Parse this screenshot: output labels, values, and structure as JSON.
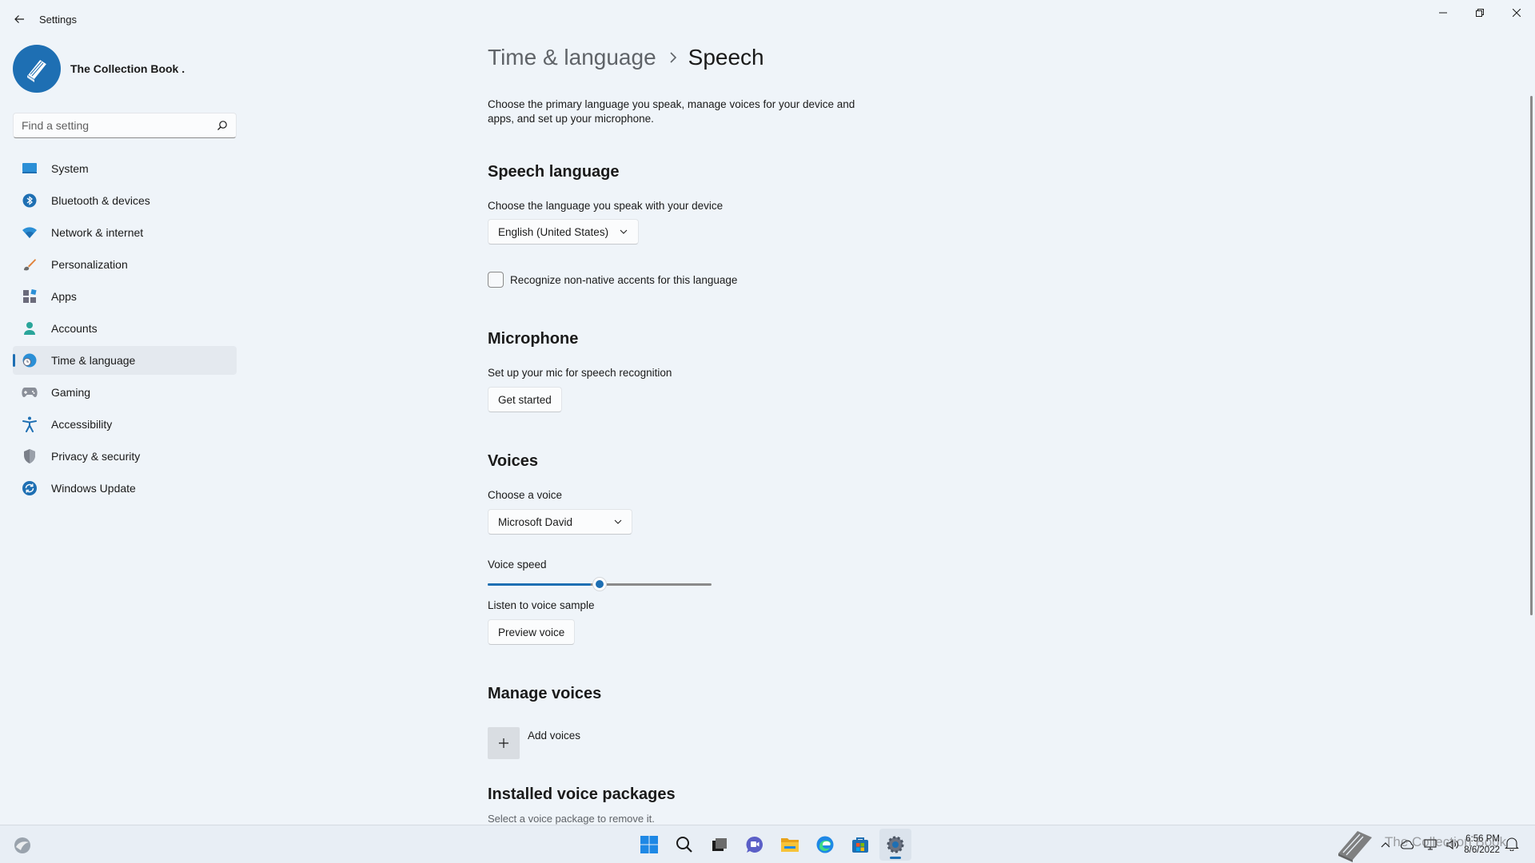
{
  "window": {
    "title": "Settings"
  },
  "profile": {
    "name": "The Collection Book ."
  },
  "search": {
    "placeholder": "Find a setting",
    "value": ""
  },
  "sidebar": {
    "items": [
      {
        "label": "System",
        "icon": "monitor-icon"
      },
      {
        "label": "Bluetooth & devices",
        "icon": "bluetooth-icon"
      },
      {
        "label": "Network & internet",
        "icon": "wifi-icon"
      },
      {
        "label": "Personalization",
        "icon": "brush-icon"
      },
      {
        "label": "Apps",
        "icon": "apps-icon"
      },
      {
        "label": "Accounts",
        "icon": "person-icon"
      },
      {
        "label": "Time & language",
        "icon": "globe-clock-icon",
        "active": true
      },
      {
        "label": "Gaming",
        "icon": "gamepad-icon"
      },
      {
        "label": "Accessibility",
        "icon": "accessibility-icon"
      },
      {
        "label": "Privacy & security",
        "icon": "shield-icon"
      },
      {
        "label": "Windows Update",
        "icon": "update-icon"
      }
    ]
  },
  "breadcrumb": {
    "parent": "Time & language",
    "current": "Speech"
  },
  "description": "Choose the primary language you speak, manage voices for your device and apps, and set up your microphone.",
  "speech_language": {
    "title": "Speech language",
    "label": "Choose the language you speak with your device",
    "selected": "English (United States)",
    "checkbox_label": "Recognize non-native accents for this language",
    "checkbox_checked": false
  },
  "microphone": {
    "title": "Microphone",
    "label": "Set up your mic for speech recognition",
    "button": "Get started"
  },
  "voices": {
    "title": "Voices",
    "choose_label": "Choose a voice",
    "selected_voice": "Microsoft David",
    "speed_label": "Voice speed",
    "speed_value": 0.5,
    "sample_label": "Listen to voice sample",
    "preview_button": "Preview voice"
  },
  "manage_voices": {
    "title": "Manage voices",
    "add_label": "Add voices"
  },
  "installed": {
    "title": "Installed voice packages",
    "subtitle": "Select a voice package to remove it."
  },
  "taskbar": {
    "apps": [
      "start-icon",
      "search-icon",
      "task-view-icon",
      "chat-icon",
      "file-explorer-icon",
      "edge-icon",
      "store-icon",
      "settings-icon"
    ],
    "time": "6:56 PM",
    "date": "8/6/2022",
    "watermark": "The Collection Book"
  },
  "colors": {
    "accent": "#1e6fb3",
    "background": "#eff4f9"
  }
}
